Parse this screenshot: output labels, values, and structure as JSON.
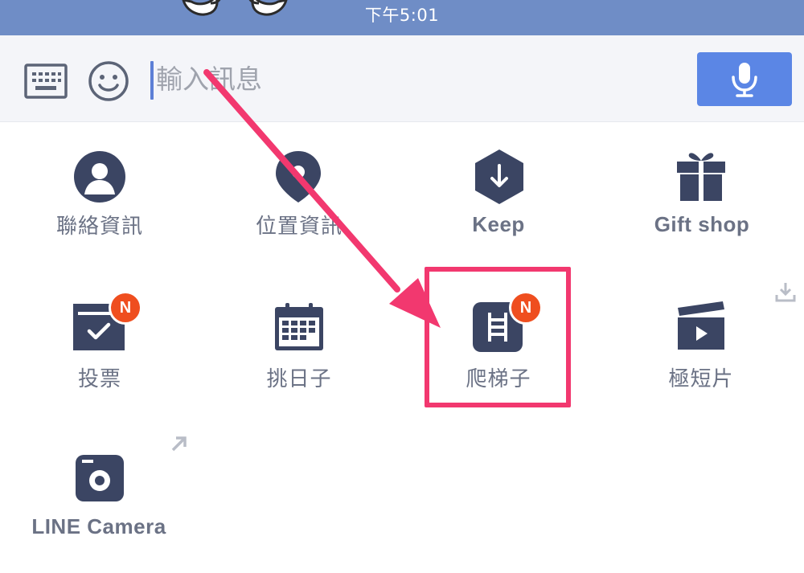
{
  "status_bar": {
    "time": "下午5:01"
  },
  "input_bar": {
    "keyboard_icon": "keyboard-icon",
    "emoji_icon": "emoji-icon",
    "placeholder": "輸入訊息",
    "mic_icon": "microphone-icon"
  },
  "menu": {
    "items": [
      {
        "label": "聯絡資訊",
        "icon": "contact-icon"
      },
      {
        "label": "位置資訊",
        "icon": "location-pin-icon"
      },
      {
        "label": "Keep",
        "icon": "keep-download-icon"
      },
      {
        "label": "Gift shop",
        "icon": "gift-icon"
      },
      {
        "label": "投票",
        "icon": "vote-ballot-icon",
        "badge": "N"
      },
      {
        "label": "挑日子",
        "icon": "calendar-icon"
      },
      {
        "label": "爬梯子",
        "icon": "ladder-icon",
        "badge": "N"
      },
      {
        "label": "極短片",
        "icon": "clapperboard-icon"
      },
      {
        "label": "LINE Camera",
        "icon": "camera-icon"
      }
    ],
    "download_icon": "download-icon",
    "external_link_icon": "external-link-icon"
  },
  "colors": {
    "status_bar": "#6f8dc6",
    "icon": "#3b4563",
    "label": "#6b7285",
    "mic_button": "#5b86e5",
    "badge": "#ef4e1f",
    "annotation": "#f2386f"
  }
}
